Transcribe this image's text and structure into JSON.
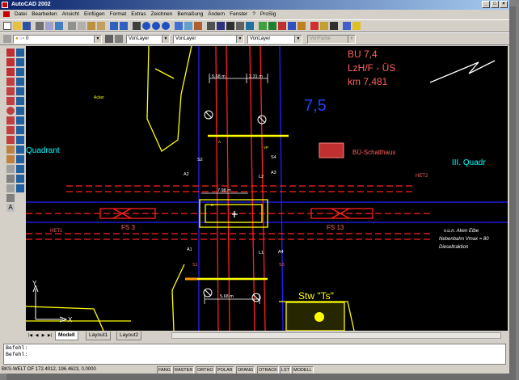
{
  "window": {
    "title": "AutoCAD 2002",
    "controls": [
      "_",
      "□",
      "×"
    ]
  },
  "menu": [
    "Datei",
    "Bearbeiten",
    "Ansicht",
    "Einfügen",
    "Format",
    "Extras",
    "Zeichnen",
    "Bemaßung",
    "Ändern",
    "Fenster",
    "?",
    "ProSig"
  ],
  "toolbar": {
    "layer_value": "0",
    "color_value": "VonLayer",
    "linetype_value": "VonLayer",
    "lineweight_value": "VonLayer",
    "plotstyle_value": "VonFarbe"
  },
  "drawing": {
    "bu_title": "BU 7,4",
    "bu_subtitle": "LzH/F - ÜS",
    "bu_km": "km 7,481",
    "big_number": "7,5",
    "quadrant_left": "Quadrant",
    "quadrant_right": "III. Quadr",
    "schalthaus": "BÜ-Schalthaus",
    "acker": "Acker",
    "dim_top_a": "5,68 m",
    "dim_top_b": "2,31 m",
    "dim_mid": "7,98 m",
    "dim_bottom": "5,68 m",
    "fs_left": "FS 3",
    "fs_right": "FS 13",
    "het1": "HET1",
    "het2": "HET2",
    "info_line1": "v.u.n. Aken Elbe",
    "info_line2": "Nebenbahn Vmax = 80",
    "info_line3": "Dieseltraktion",
    "stw": "Stw \"Ts\"",
    "lbl_s2": "S2",
    "lbl_s4": "S4",
    "lbl_s1": "S1",
    "lbl_s3": "S3",
    "lbl_a2": "A2",
    "lbl_a1": "A1",
    "lbl_a3": "A3",
    "lbl_a4": "A4",
    "lbl_l2": "L2",
    "lbl_l1": "L1",
    "lbl_vp": "VP",
    "lbl_a": "A",
    "lbl_b": "B",
    "axis_y": "Y",
    "axis_x": "X"
  },
  "tabs": {
    "model": "Modell",
    "layout1": "Layout1",
    "layout2": "Layout2"
  },
  "command": {
    "line1": "Befehl:",
    "line2": "Befehl:"
  },
  "status": {
    "coords": "BKS-WELT OF 172.4012, 196.4623, 0.0000",
    "modes": [
      "FANG",
      "RASTER",
      "ORTHO",
      "POLAR",
      "OFANG",
      "OTRACK",
      "LST",
      "MODELL"
    ]
  },
  "colors": {
    "canvas": "#000000",
    "rails": "#ff2020",
    "road": "#ffff00",
    "tracks": "#2020ff",
    "cyan": "#00ffff",
    "pink": "#ff4040"
  }
}
